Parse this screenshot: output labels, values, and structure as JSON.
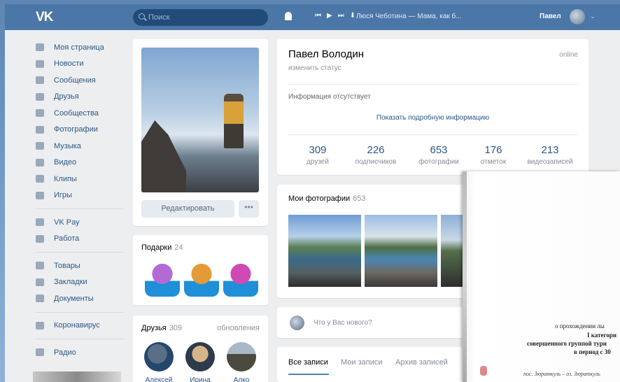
{
  "topbar": {
    "search_placeholder": "Поиск",
    "player": {
      "prev": "⏮",
      "play": "▶",
      "next": "⏭",
      "download": "⬇"
    },
    "track": "Люся Чеботина — Мама, как б...",
    "user_name": "Павел",
    "caret": "⌄"
  },
  "sidebar": {
    "items": [
      {
        "label": "Моя страница",
        "icon": "home-icon"
      },
      {
        "label": "Новости",
        "icon": "news-icon"
      },
      {
        "label": "Сообщения",
        "icon": "message-icon"
      },
      {
        "label": "Друзья",
        "icon": "friend-icon"
      },
      {
        "label": "Сообщества",
        "icon": "groups-icon"
      },
      {
        "label": "Фотографии",
        "icon": "camera-icon"
      },
      {
        "label": "Музыка",
        "icon": "music-icon"
      },
      {
        "label": "Видео",
        "icon": "video-icon"
      },
      {
        "label": "Клипы",
        "icon": "clips-icon"
      },
      {
        "label": "Игры",
        "icon": "gamepad-icon"
      },
      {
        "label": "VK Pay",
        "icon": "pay-icon"
      },
      {
        "label": "Работа",
        "icon": "briefcase-icon"
      },
      {
        "label": "Товары",
        "icon": "shop-icon"
      },
      {
        "label": "Закладки",
        "icon": "star-icon"
      },
      {
        "label": "Документы",
        "icon": "document-icon"
      },
      {
        "label": "Коронавирус",
        "icon": "virus-icon"
      },
      {
        "label": "Радио",
        "icon": "radio-icon"
      }
    ]
  },
  "profile": {
    "edit_button": "Редактировать",
    "more_button": "•••",
    "name": "Павел Володин",
    "status": "изменить статус",
    "online": "online",
    "info": "Информация отсутствует",
    "show_more": "Показать подробную информацию",
    "stats": [
      {
        "value": "309",
        "label": "друзей"
      },
      {
        "value": "226",
        "label": "подписчиков"
      },
      {
        "value": "653",
        "label": "фотографии"
      },
      {
        "value": "176",
        "label": "отметок"
      },
      {
        "value": "213",
        "label": "видеозаписей"
      }
    ]
  },
  "gifts": {
    "title": "Подарки",
    "count": "24"
  },
  "friends": {
    "title": "Друзья",
    "count": "309",
    "updates": "обновления",
    "list": [
      {
        "name": "Алексей"
      },
      {
        "name": "Ирина"
      },
      {
        "name": "Алко"
      }
    ]
  },
  "photos": {
    "title": "Мои фотографии",
    "count": "653"
  },
  "post": {
    "placeholder": "Что у Вас нового?"
  },
  "wall": {
    "tabs": [
      "Все записи",
      "Мои записи",
      "Архив записей"
    ]
  },
  "overlay_doc": {
    "lines": [
      "о прохождении лы",
      "I категори",
      "совершенного группой тури",
      "в период с 30"
    ],
    "footer": "пос. Зюраткуль – оз. Зюраткуль"
  }
}
